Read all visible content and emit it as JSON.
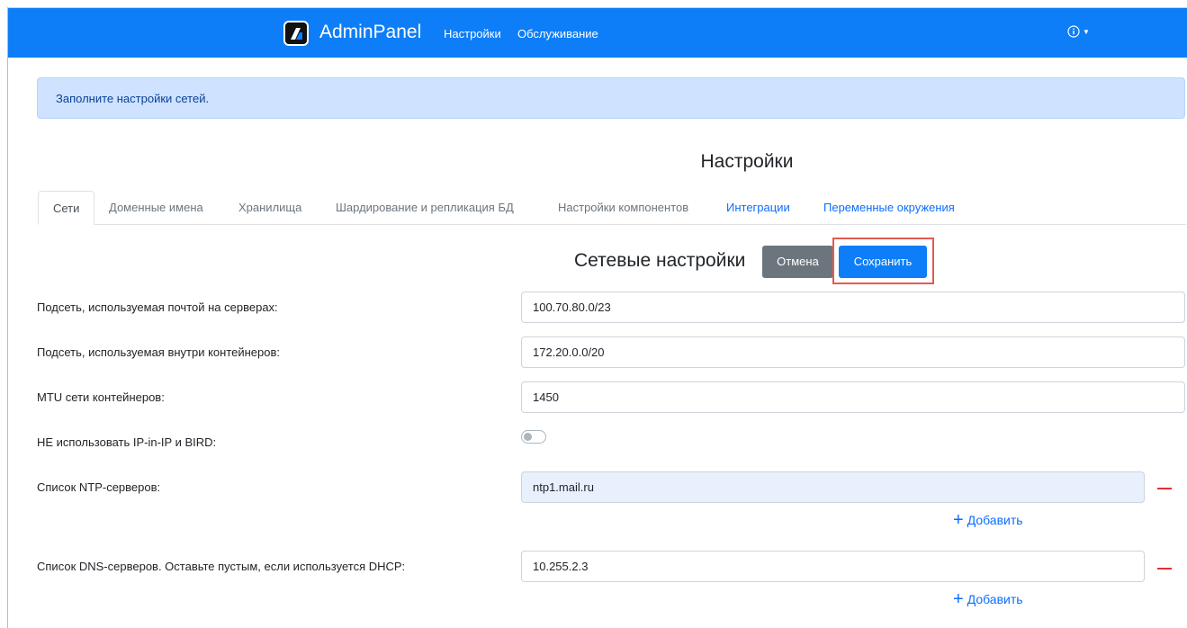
{
  "navbar": {
    "brand": "AdminPanel",
    "links": [
      "Настройки",
      "Обслуживание"
    ],
    "info_icon": "info-circle-icon"
  },
  "alert": {
    "text": "Заполните настройки сетей."
  },
  "page_title": "Настройки",
  "tabs": [
    {
      "label": "Сети",
      "active": true
    },
    {
      "label": "Доменные имена"
    },
    {
      "label": "Хранилища"
    },
    {
      "label": "Шардирование и репликация БД"
    },
    {
      "label": "Настройки компонентов"
    },
    {
      "label": "Интеграции"
    },
    {
      "label": "Переменные окружения"
    }
  ],
  "section": {
    "title": "Сетевые настройки",
    "cancel": "Отмена",
    "save": "Сохранить"
  },
  "fields": {
    "mail_subnet": {
      "label": "Подсеть, используемая почтой на серверах:",
      "value": "100.70.80.0/23"
    },
    "container_subnet": {
      "label": "Подсеть, используемая внутри контейнеров:",
      "value": "172.20.0.0/20"
    },
    "mtu": {
      "label": "MTU сети контейнеров:",
      "value": "1450"
    },
    "no_ipip": {
      "label": "НЕ использовать IP-in-IP и BIRD:",
      "enabled": false
    },
    "ntp": {
      "label": "Список NTP-серверов:",
      "values": [
        "ntp1.mail.ru"
      ]
    },
    "dns": {
      "label": "Список DNS-серверов. Оставьте пустым, если используется DHCP:",
      "values": [
        "10.255.2.3"
      ]
    }
  },
  "add_label": "Добавить",
  "colors": {
    "primary": "#0d7ef7",
    "danger": "#e03131",
    "secondary": "#6c757d"
  }
}
